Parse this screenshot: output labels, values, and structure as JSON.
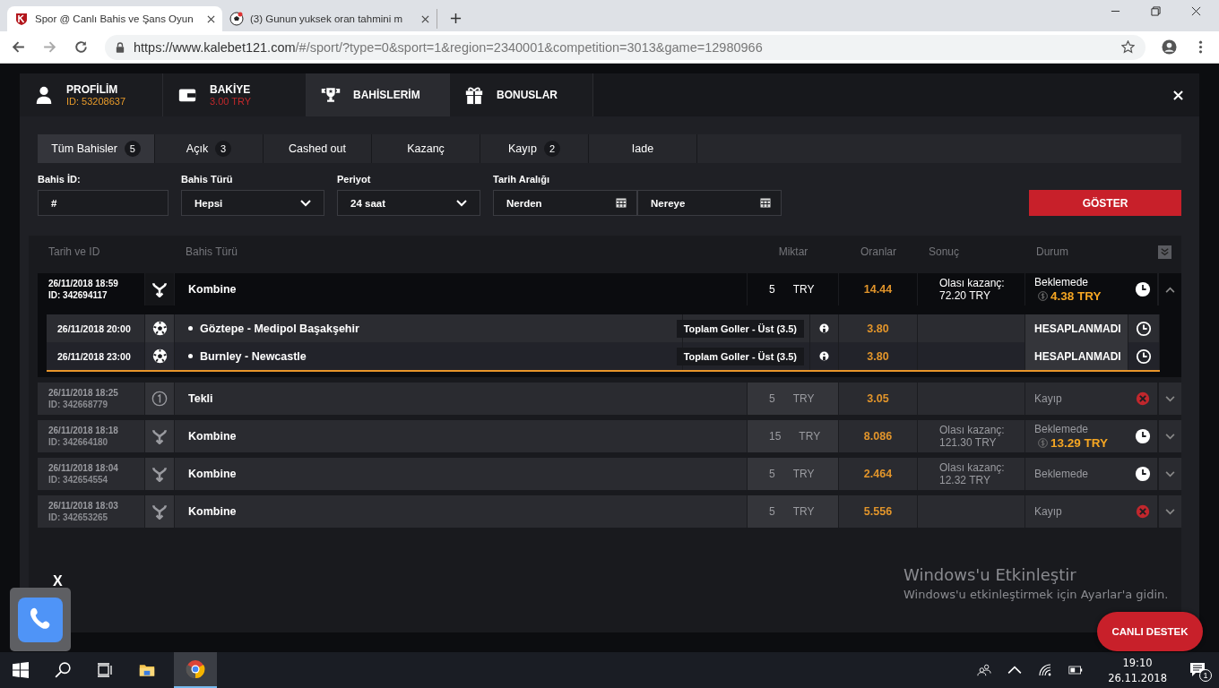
{
  "browser": {
    "tabs": [
      {
        "title": "Spor @ Canlı Bahis ve Şans Oyun",
        "kind": "site",
        "selected": true
      },
      {
        "title": "(3) Gunun yuksek oran tahmini m",
        "kind": "ball",
        "selected": false
      }
    ],
    "url_origin": "https://www.kalebet121.com",
    "url_path": "/#/sport/?type=0&sport=1&region=2340001&competition=3013&game=12980966"
  },
  "account_tabs": [
    {
      "kind": "profile",
      "label": "PROFİLİM",
      "sub": "ID: 53208637",
      "color": "#e89b2a",
      "selected": false
    },
    {
      "kind": "balance",
      "label": "BAKİYE",
      "sub": "3.00 TRY",
      "color": "#c0282b",
      "selected": false
    },
    {
      "kind": "bets",
      "label": "BAHİSLERİM",
      "selected": true
    },
    {
      "kind": "bonus",
      "label": "BONUSLAR",
      "selected": false
    }
  ],
  "filter_tabs": [
    {
      "label": "Tüm Bahisler",
      "count": "5",
      "selected": true
    },
    {
      "label": "Açık",
      "count": "3",
      "selected": false
    },
    {
      "label": "Cashed out",
      "selected": false
    },
    {
      "label": "Kazanç",
      "selected": false
    },
    {
      "label": "Kayıp",
      "count": "2",
      "selected": false
    },
    {
      "label": "Iade",
      "selected": false
    }
  ],
  "filters": [
    {
      "kind": "input",
      "label": "Bahis İD:",
      "placeholder": "#"
    },
    {
      "kind": "select",
      "label": "Bahis Türü",
      "value": "Hepsi"
    },
    {
      "kind": "select",
      "label": "Periyot",
      "value": "24 saat"
    },
    {
      "kind": "dates",
      "label": "Tarih Aralığı",
      "from_placeholder": "Nerden",
      "to_placeholder": "Nereye"
    }
  ],
  "show_button": "GÖSTER",
  "table": {
    "columns": [
      "Tarih ve ID",
      "Bahis Türü",
      "Miktar",
      "Oranlar",
      "Sonuç",
      "Durum"
    ],
    "rows": [
      {
        "date": "26/11/2018 18:59",
        "id": "ID: 342694117",
        "kind": "kombine",
        "type": "Kombine",
        "amount": "5",
        "currency": "TRY",
        "odds": "14.44",
        "result_label": "Olası kazanç:",
        "result_amount": "72.20",
        "result_currency": "TRY",
        "status": {
          "kind": "pending",
          "text": "Beklemede"
        },
        "cashout": "4.38 TRY",
        "expanded": true,
        "events": [
          {
            "date": "26/11/2018 20:00",
            "match": "Göztepe - Medipol Başakşehir",
            "market": "Toplam Goller - Üst (3.5)",
            "odds": "3.80",
            "status": "HESAPLANMADI"
          },
          {
            "date": "26/11/2018 23:00",
            "match": "Burnley - Newcastle",
            "market": "Toplam Goller - Üst (3.5)",
            "odds": "3.80",
            "status": "HESAPLANMADI"
          }
        ]
      },
      {
        "date": "26/11/2018 18:25",
        "id": "ID: 342668779",
        "kind": "tekli",
        "type": "Tekli",
        "amount": "5",
        "currency": "TRY",
        "odds": "3.05",
        "status": {
          "kind": "lost",
          "text": "Kayıp"
        },
        "expanded": false
      },
      {
        "date": "26/11/2018 18:18",
        "id": "ID: 342664180",
        "kind": "kombine",
        "type": "Kombine",
        "amount": "15",
        "currency": "TRY",
        "odds": "8.086",
        "result_label": "Olası kazanç:",
        "result_amount": "121.30",
        "result_currency": "TRY",
        "status": {
          "kind": "pending",
          "text": "Beklemede"
        },
        "cashout": "13.29 TRY",
        "expanded": false
      },
      {
        "date": "26/11/2018 18:04",
        "id": "ID: 342654554",
        "kind": "kombine",
        "type": "Kombine",
        "amount": "5",
        "currency": "TRY",
        "odds": "2.464",
        "result_label": "Olası kazanç:",
        "result_amount": "12.32",
        "result_currency": "TRY",
        "status": {
          "kind": "pending",
          "text": "Beklemede"
        },
        "expanded": false
      },
      {
        "date": "26/11/2018 18:03",
        "id": "ID: 342653265",
        "kind": "kombine",
        "type": "Kombine",
        "amount": "5",
        "currency": "TRY",
        "odds": "5.556",
        "status": {
          "kind": "lost",
          "text": "Kayıp"
        },
        "expanded": false
      }
    ]
  },
  "phone_widget": {
    "close": "X"
  },
  "live_support_button": "CANLI DESTEK",
  "activation": {
    "title": "Windows'u Etkinleştir",
    "text": "Windows'u etkinleştirmek için Ayarlar'a gidin."
  },
  "taskbar": {
    "time": "19:10",
    "date": "26.11.2018",
    "notifications": "1"
  }
}
